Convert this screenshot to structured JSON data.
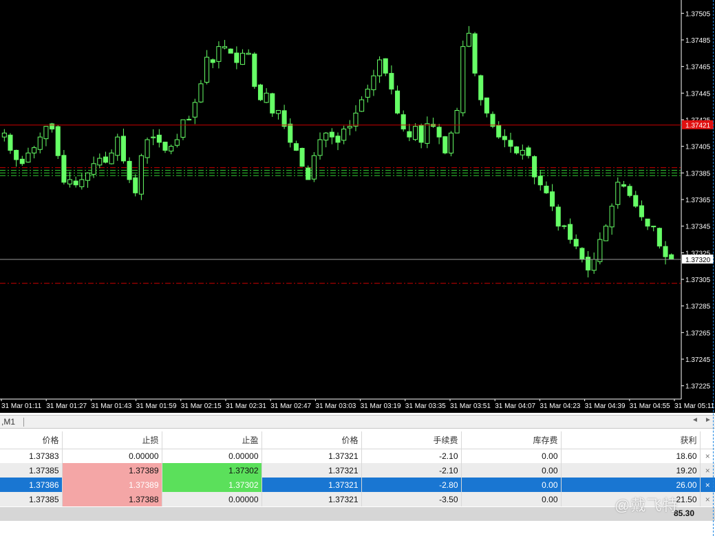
{
  "chart": {
    "colors": {
      "background": "#000000",
      "candle": "#66ff66",
      "axis_text": "#ffffff",
      "bid_line": "#cc0000",
      "ask_line": "#9a9a9a",
      "sl_line": "#cc0000",
      "tp_line": "#33cc33"
    },
    "price_axis": {
      "min": 1.37215,
      "max": 1.37515,
      "ticks": [
        "1.37505",
        "1.37485",
        "1.37465",
        "1.37445",
        "1.37425",
        "1.37405",
        "1.37385",
        "1.37365",
        "1.37345",
        "1.37325",
        "1.37305",
        "1.37285",
        "1.37265",
        "1.37245",
        "1.37225"
      ]
    },
    "time_axis": [
      "31 Mar 01:11",
      "31 Mar 01:27",
      "31 Mar 01:43",
      "31 Mar 01:59",
      "31 Mar 02:15",
      "31 Mar 02:31",
      "31 Mar 02:47",
      "31 Mar 03:03",
      "31 Mar 03:19",
      "31 Mar 03:35",
      "31 Mar 03:51",
      "31 Mar 04:07",
      "31 Mar 04:23",
      "31 Mar 04:39",
      "31 Mar 04:55",
      "31 Mar 05:11"
    ],
    "bid_price": 1.37421,
    "bid_label": "1.37421",
    "ask_price": 1.3732,
    "ask_label": "1.37320",
    "order_lines": [
      {
        "price": 1.37389,
        "type": "sl"
      },
      {
        "price": 1.37387,
        "type": "tp"
      },
      {
        "price": 1.37385,
        "type": "tp"
      },
      {
        "price": 1.37383,
        "type": "tp"
      },
      {
        "price": 1.37302,
        "type": "sl"
      }
    ],
    "close_series": [
      1.37415,
      1.37402,
      1.37395,
      1.37392,
      1.374,
      1.37404,
      1.37412,
      1.3742,
      1.37418,
      1.37398,
      1.37378,
      1.3738,
      1.37376,
      1.3738,
      1.37385,
      1.37392,
      1.37396,
      1.37393,
      1.374,
      1.37412,
      1.37394,
      1.3738,
      1.3737,
      1.37398,
      1.3741,
      1.37412,
      1.37408,
      1.37402,
      1.37405,
      1.3741,
      1.37425,
      1.37425,
      1.37438,
      1.37452,
      1.37472,
      1.37468,
      1.3748,
      1.3748,
      1.37475,
      1.37468,
      1.37475,
      1.37475,
      1.3745,
      1.3744,
      1.37445,
      1.3743,
      1.37432,
      1.3742,
      1.37408,
      1.37402,
      1.3739,
      1.3738,
      1.37398,
      1.3741,
      1.37415,
      1.37412,
      1.37408,
      1.37418,
      1.3742,
      1.3743,
      1.3744,
      1.37448,
      1.37458,
      1.3747,
      1.3746,
      1.37448,
      1.3743,
      1.37418,
      1.37412,
      1.3742,
      1.37408,
      1.37422,
      1.3742,
      1.37412,
      1.374,
      1.37415,
      1.37432,
      1.3748,
      1.3749,
      1.3746,
      1.3744,
      1.3743,
      1.3742,
      1.37412,
      1.3741,
      1.37405,
      1.374,
      1.37402,
      1.37398,
      1.37382,
      1.37376,
      1.3737,
      1.3736,
      1.37345,
      1.37345,
      1.37335,
      1.3733,
      1.3732,
      1.37312,
      1.3732,
      1.37335,
      1.37345,
      1.3736,
      1.37378,
      1.37375,
      1.37368,
      1.3736,
      1.37352,
      1.37345,
      1.37345,
      1.3733,
      1.37322,
      1.3732
    ]
  },
  "panel": {
    "tab_label": ",M1",
    "columns": [
      "价格",
      "止损",
      "止盈",
      "价格",
      "手续费",
      "库存费",
      "获利"
    ],
    "rows": [
      {
        "open_price": "1.37383",
        "sl": "0.00000",
        "tp": "0.00000",
        "price": "1.37321",
        "commission": "-2.10",
        "swap": "0.00",
        "profit": "18.60",
        "sl_hit": false,
        "tp_hit": false,
        "selected": false
      },
      {
        "open_price": "1.37385",
        "sl": "1.37389",
        "tp": "1.37302",
        "price": "1.37321",
        "commission": "-2.10",
        "swap": "0.00",
        "profit": "19.20",
        "sl_hit": true,
        "tp_hit": true,
        "selected": false
      },
      {
        "open_price": "1.37386",
        "sl": "1.37389",
        "tp": "1.37302",
        "price": "1.37321",
        "commission": "-2.80",
        "swap": "0.00",
        "profit": "26.00",
        "sl_hit": true,
        "tp_hit": true,
        "selected": true
      },
      {
        "open_price": "1.37385",
        "sl": "1.37388",
        "tp": "0.00000",
        "price": "1.37321",
        "commission": "-3.50",
        "swap": "0.00",
        "profit": "21.50",
        "sl_hit": true,
        "tp_hit": false,
        "selected": false
      }
    ],
    "close_symbol": "×",
    "total": "85.30"
  },
  "watermark": "@戴飞特"
}
